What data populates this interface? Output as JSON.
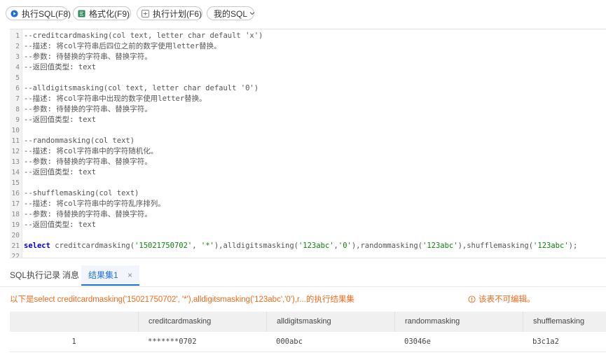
{
  "toolbar": {
    "run_label": "执行SQL(F8)",
    "format_label": "格式化(F9)",
    "plan_label": "执行计划(F6)",
    "mysql_label": "我的SQL"
  },
  "editor": {
    "lines": [
      {
        "n": "1",
        "segs": [
          {
            "t": "--creditcardmasking(col text, letter char default 'x')",
            "c": "cm"
          }
        ]
      },
      {
        "n": "2",
        "segs": [
          {
            "t": "--描述: 将col字符串后四位之前的数字使用letter替换。",
            "c": "cm"
          }
        ]
      },
      {
        "n": "3",
        "segs": [
          {
            "t": "--参数: 待替换的字符串、替换字符。",
            "c": "cm"
          }
        ]
      },
      {
        "n": "4",
        "segs": [
          {
            "t": "--返回值类型: text",
            "c": "cm"
          }
        ]
      },
      {
        "n": "5",
        "segs": []
      },
      {
        "n": "6",
        "segs": [
          {
            "t": "--alldigitsmasking(col text, letter char default '0')",
            "c": "cm"
          }
        ]
      },
      {
        "n": "7",
        "segs": [
          {
            "t": "--描述: 将col字符串中出现的数字使用letter替换。",
            "c": "cm"
          }
        ]
      },
      {
        "n": "8",
        "segs": [
          {
            "t": "--参数: 待替换的字符串、替换字符。",
            "c": "cm"
          }
        ]
      },
      {
        "n": "9",
        "segs": [
          {
            "t": "--返回值类型: text",
            "c": "cm"
          }
        ]
      },
      {
        "n": "10",
        "segs": []
      },
      {
        "n": "11",
        "segs": [
          {
            "t": "--randommasking(col text)",
            "c": "cm"
          }
        ]
      },
      {
        "n": "12",
        "segs": [
          {
            "t": "--描述: 将col字符串中的字符随机化。",
            "c": "cm"
          }
        ]
      },
      {
        "n": "13",
        "segs": [
          {
            "t": "--参数: 待替换的字符串、替换字符。",
            "c": "cm"
          }
        ]
      },
      {
        "n": "14",
        "segs": [
          {
            "t": "--返回值类型: text",
            "c": "cm"
          }
        ]
      },
      {
        "n": "15",
        "segs": []
      },
      {
        "n": "16",
        "segs": [
          {
            "t": "--shufflemasking(col text)",
            "c": "cm"
          }
        ]
      },
      {
        "n": "17",
        "segs": [
          {
            "t": "--描述: 将col字符串中的字符乱序排列。",
            "c": "cm"
          }
        ]
      },
      {
        "n": "18",
        "segs": [
          {
            "t": "--参数: 待替换的字符串、替换字符。",
            "c": "cm"
          }
        ]
      },
      {
        "n": "19",
        "segs": [
          {
            "t": "--返回值类型: text",
            "c": "cm"
          }
        ]
      },
      {
        "n": "20",
        "segs": []
      },
      {
        "n": "21",
        "segs": [
          {
            "t": "select",
            "c": "kw"
          },
          {
            "t": " creditcardmasking(",
            "c": "pl"
          },
          {
            "t": "'15021750702'",
            "c": "str"
          },
          {
            "t": ", ",
            "c": "pl"
          },
          {
            "t": "'*'",
            "c": "str"
          },
          {
            "t": "),alldigitsmasking(",
            "c": "pl"
          },
          {
            "t": "'123abc'",
            "c": "str"
          },
          {
            "t": ",",
            "c": "pl"
          },
          {
            "t": "'0'",
            "c": "str"
          },
          {
            "t": "),randommasking(",
            "c": "pl"
          },
          {
            "t": "'123abc'",
            "c": "str"
          },
          {
            "t": "),shufflemasking(",
            "c": "pl"
          },
          {
            "t": "'123abc'",
            "c": "str"
          },
          {
            "t": ");",
            "c": "pl"
          }
        ]
      },
      {
        "n": "22",
        "segs": []
      }
    ]
  },
  "tabs": {
    "history": "SQL执行记录",
    "messages": "消息",
    "result": "结果集1",
    "close": "×"
  },
  "notice": {
    "summary": "以下是select creditcardmasking('15021750702', '*'),alldigitsmasking('123abc','0'),r...的执行结果集",
    "readonly": "该表不可编辑。"
  },
  "grid": {
    "columns": [
      "creditcardmasking",
      "alldigitsmasking",
      "randommasking",
      "shufflemasking"
    ],
    "rows": [
      {
        "index": "1",
        "cells": [
          "*******0702",
          "000abc",
          "03046e",
          "b3c1a2"
        ]
      }
    ]
  },
  "colors": {
    "accent": "#1e6fd9",
    "warning": "#f06a1b",
    "keyword": "#0000cc",
    "string": "#0d7f0d"
  }
}
